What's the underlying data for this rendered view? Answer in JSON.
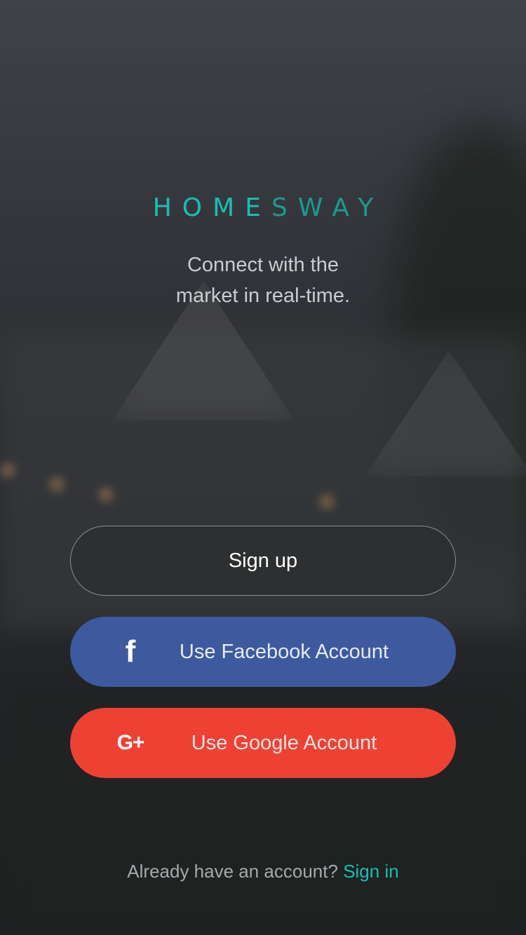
{
  "brand": {
    "name_part1": "HOME",
    "name_part2": "SWAY",
    "accent_color": "#17c0b4"
  },
  "tagline": {
    "line1": "Connect with the",
    "line2": "market in real-time."
  },
  "buttons": {
    "signup_label": "Sign up",
    "facebook_label": "Use Facebook Account",
    "facebook_icon": "facebook-icon",
    "facebook_color": "#3d5a9e",
    "google_label": "Use Google Account",
    "google_icon": "google-plus-icon",
    "google_color": "#ef4034"
  },
  "footer": {
    "prompt": "Already have an account?",
    "signin_label": "Sign in"
  }
}
